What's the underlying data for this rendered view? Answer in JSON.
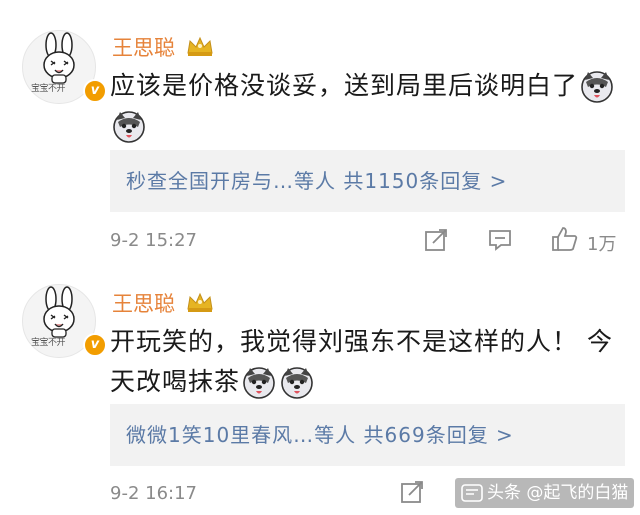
{
  "comments": [
    {
      "username": "王思聪",
      "avatar_caption": "宝宝不开",
      "content_lines": [
        "应该是价格没谈妥，送到局里后谈明白了"
      ],
      "reply_summary": "秒查全国开房与…等人  共1150条回复 >",
      "time": "9-2 15:27",
      "likes": "1万"
    },
    {
      "username": "王思聪",
      "avatar_caption": "宝宝不开",
      "content_lines": [
        "开玩笑的，我觉得刘强东不是这样的人！ 今",
        "天改喝抹茶"
      ],
      "reply_summary": "微微1笑10里春风…等人  共669条回复 >",
      "time": "9-2 16:17"
    }
  ],
  "watermark": {
    "text": "头条 @起飞的白猫"
  },
  "icons": [
    "crown-icon",
    "vip-badge-icon",
    "husky-emoji-icon",
    "share-icon",
    "comment-icon",
    "like-icon"
  ],
  "colors": {
    "username": "#e6833a",
    "reply_link": "#5b7aa6",
    "meta": "#8a8a8a",
    "reply_bg": "#f2f2f2",
    "badge": "#f29d00"
  }
}
